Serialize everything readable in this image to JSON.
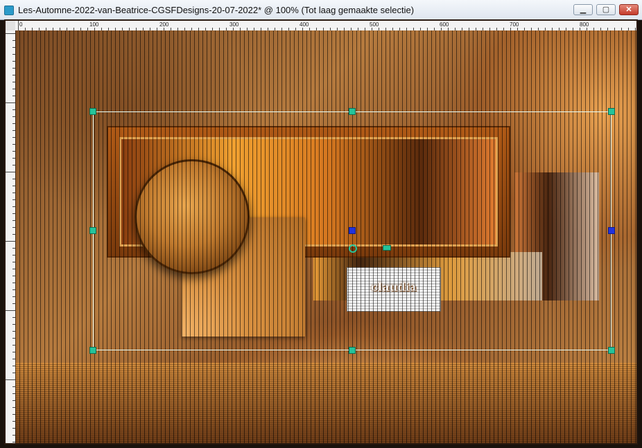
{
  "window": {
    "title": "Les-Automne-2022-van-Beatrice-CGSFDesigns-20-07-2022* @ 100% (Tot laag gemaakte selectie)",
    "controls": {
      "minimize": "▁",
      "maximize": "▢",
      "close": "✕"
    }
  },
  "ruler": {
    "labels": [
      "0",
      "100",
      "200",
      "300",
      "400",
      "500",
      "600",
      "700",
      "800"
    ]
  },
  "watermark": {
    "text": "claudia"
  },
  "colors": {
    "handle": "#25c49a",
    "handle_alt": "#2233dd",
    "selection_border": "#e8fff8"
  }
}
